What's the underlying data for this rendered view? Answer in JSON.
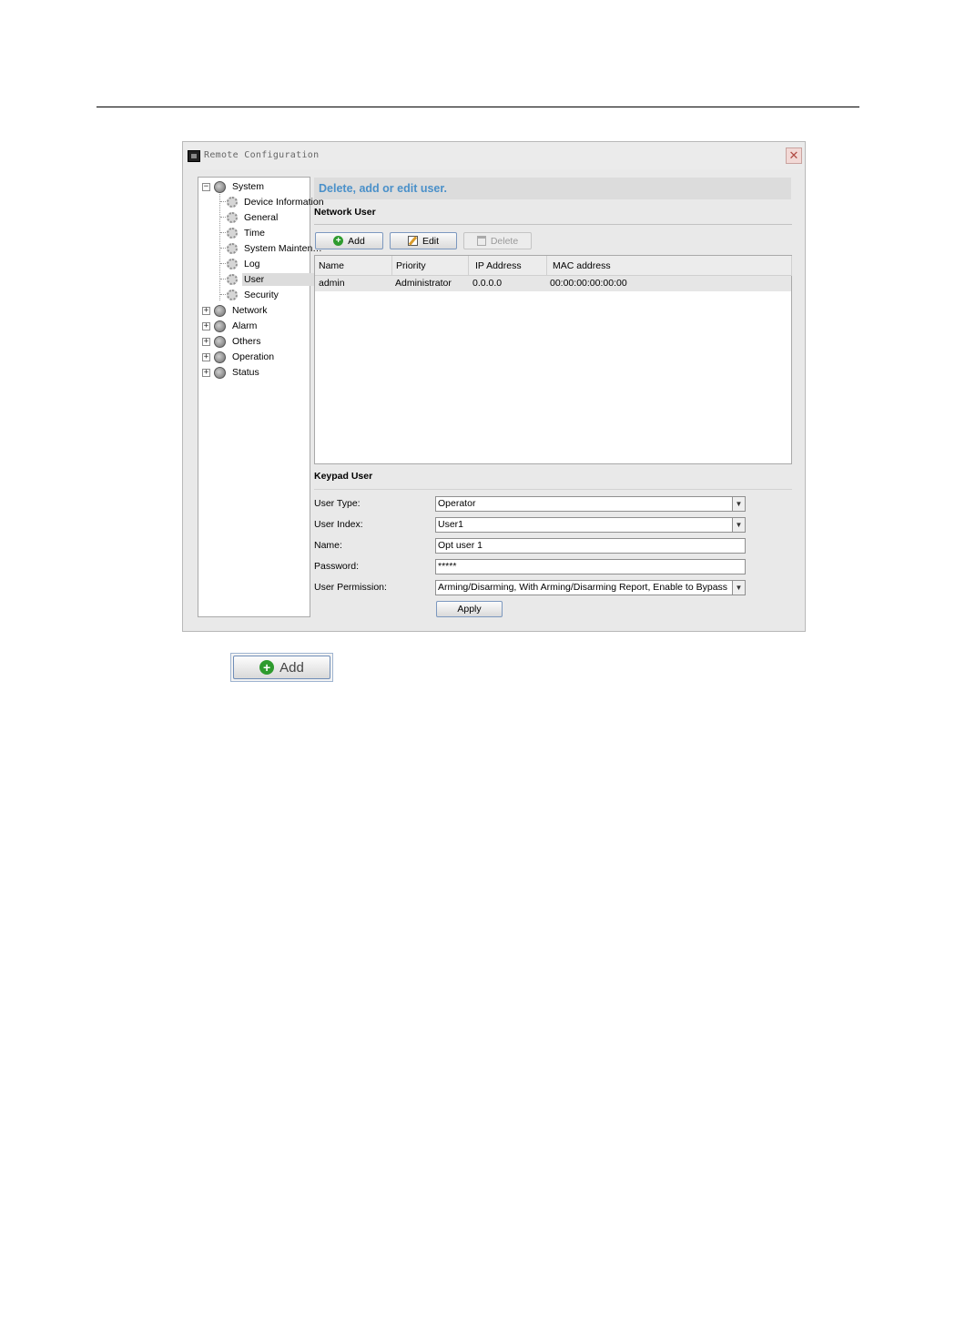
{
  "window": {
    "title": "Remote Configuration",
    "close_glyph": "✕"
  },
  "tree": {
    "expander_collapse": "−",
    "expander_expand": "+",
    "system": {
      "label": "System",
      "icon": "globe-icon"
    },
    "children": [
      {
        "label": "Device Information",
        "icon": "gear-icon"
      },
      {
        "label": "General",
        "icon": "gear-icon"
      },
      {
        "label": "Time",
        "icon": "gear-icon"
      },
      {
        "label": "System Maintenance",
        "icon": "gear-icon"
      },
      {
        "label": "Log",
        "icon": "gear-icon"
      },
      {
        "label": "User",
        "icon": "gear-icon",
        "selected": true
      },
      {
        "label": "Security",
        "icon": "gear-icon"
      }
    ],
    "roots": [
      {
        "label": "Network",
        "icon": "globe-icon"
      },
      {
        "label": "Alarm",
        "icon": "globe-icon"
      },
      {
        "label": "Others",
        "icon": "globe-icon"
      },
      {
        "label": "Operation",
        "icon": "globe-icon"
      },
      {
        "label": "Status",
        "icon": "globe-icon"
      }
    ]
  },
  "main": {
    "header": "Delete, add or edit user.",
    "network_user": {
      "title": "Network User",
      "add_label": "Add",
      "edit_label": "Edit",
      "delete_label": "Delete",
      "columns": [
        "Name",
        "Priority",
        "IP Address",
        "MAC address"
      ],
      "rows": [
        [
          "admin",
          "Administrator",
          "0.0.0.0",
          "00:00:00:00:00:00"
        ]
      ]
    },
    "keypad_user": {
      "title": "Keypad User",
      "user_type_label": "User Type:",
      "user_type_value": "Operator",
      "user_index_label": "User Index:",
      "user_index_value": "User1",
      "name_label": "Name:",
      "name_value": "Opt user 1",
      "password_label": "Password:",
      "password_value": "*****",
      "permission_label": "User Permission:",
      "permission_value": "Arming/Disarming, With Arming/Disarming Report, Enable to Bypass",
      "apply_label": "Apply",
      "arrow_glyph": "▼"
    }
  },
  "standalone_add": {
    "label": "Add",
    "plus_glyph": "+"
  },
  "colors": {
    "header_text": "#4a90c9",
    "add_icon": "#2e9b2e"
  }
}
